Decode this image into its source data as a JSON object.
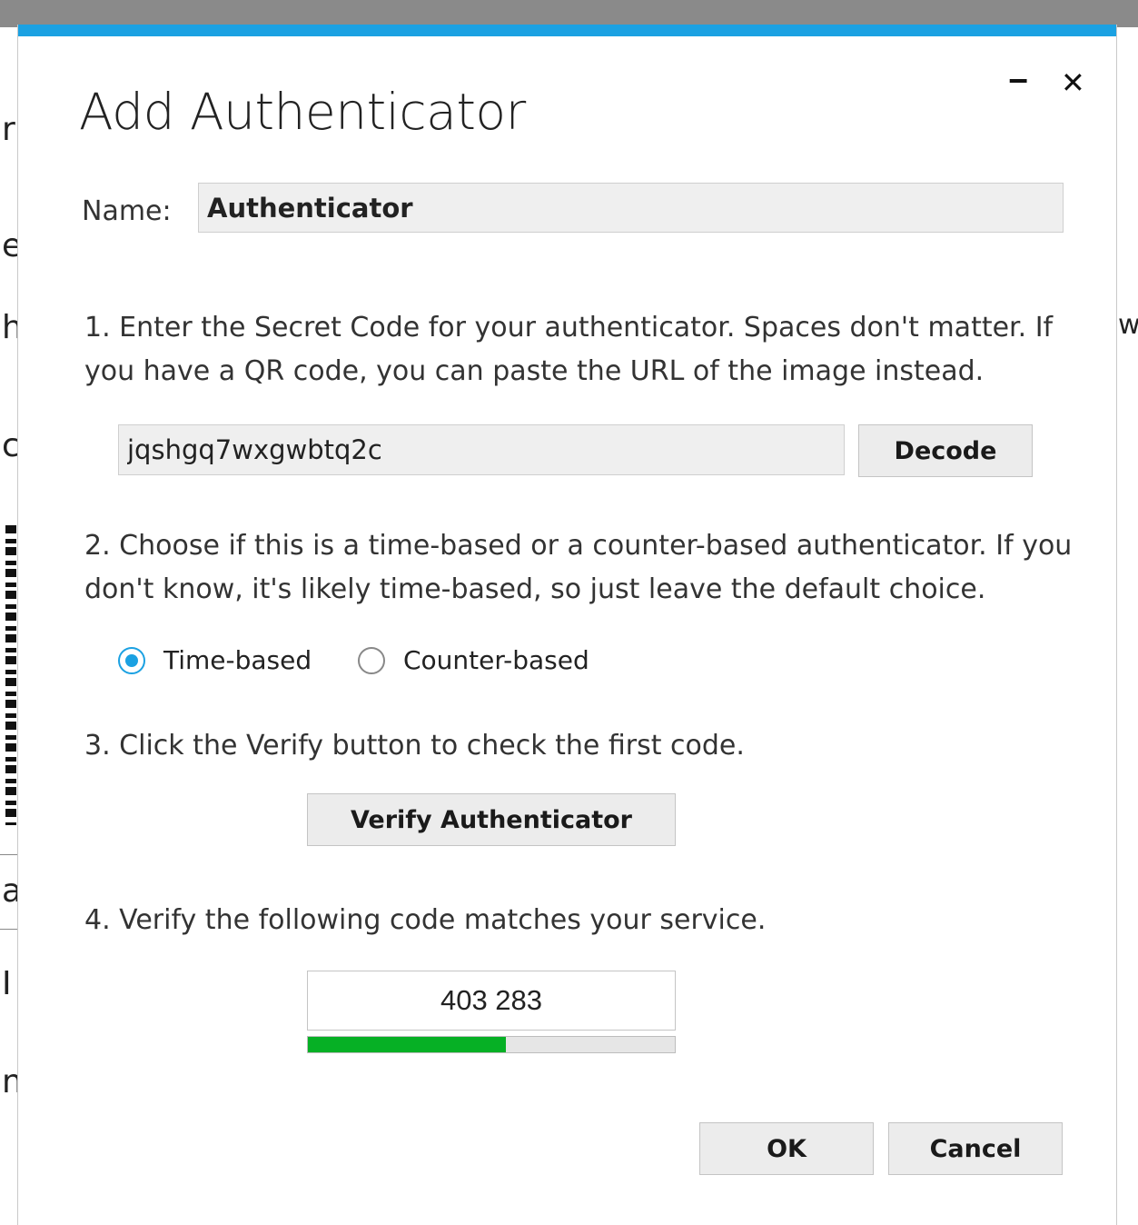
{
  "background": {
    "fragments": [
      "r",
      "e",
      "h",
      "c",
      "a",
      "I",
      "n",
      "w"
    ]
  },
  "window_controls": {
    "minimize_icon": "minimize-icon",
    "close_icon": "close-icon",
    "minimize_glyph": "‒",
    "close_glyph": "✕"
  },
  "dialog": {
    "title": "Add Authenticator",
    "accent_color": "#1ba1e2",
    "name": {
      "label": "Name:",
      "value": "Authenticator"
    },
    "step1": {
      "text": "1. Enter the Secret Code for your authenticator. Spaces don't matter. If you have a QR code, you can paste the URL of the image instead.",
      "secret_value": "jqshgq7wxgwbtq2c",
      "decode_label": "Decode"
    },
    "step2": {
      "text": "2. Choose if this is a time-based or a counter-based authenticator. If you don't know, it's likely time-based, so just leave the default choice.",
      "options": [
        {
          "label": "Time-based",
          "selected": true
        },
        {
          "label": "Counter-based",
          "selected": false
        }
      ]
    },
    "step3": {
      "text": "3. Click the Verify button to check the first code.",
      "verify_label": "Verify Authenticator"
    },
    "step4": {
      "text": "4. Verify the following code matches your service.",
      "code": "403 283",
      "progress_fraction": 0.54,
      "progress_color": "#06b025"
    },
    "ok_label": "OK",
    "cancel_label": "Cancel"
  }
}
